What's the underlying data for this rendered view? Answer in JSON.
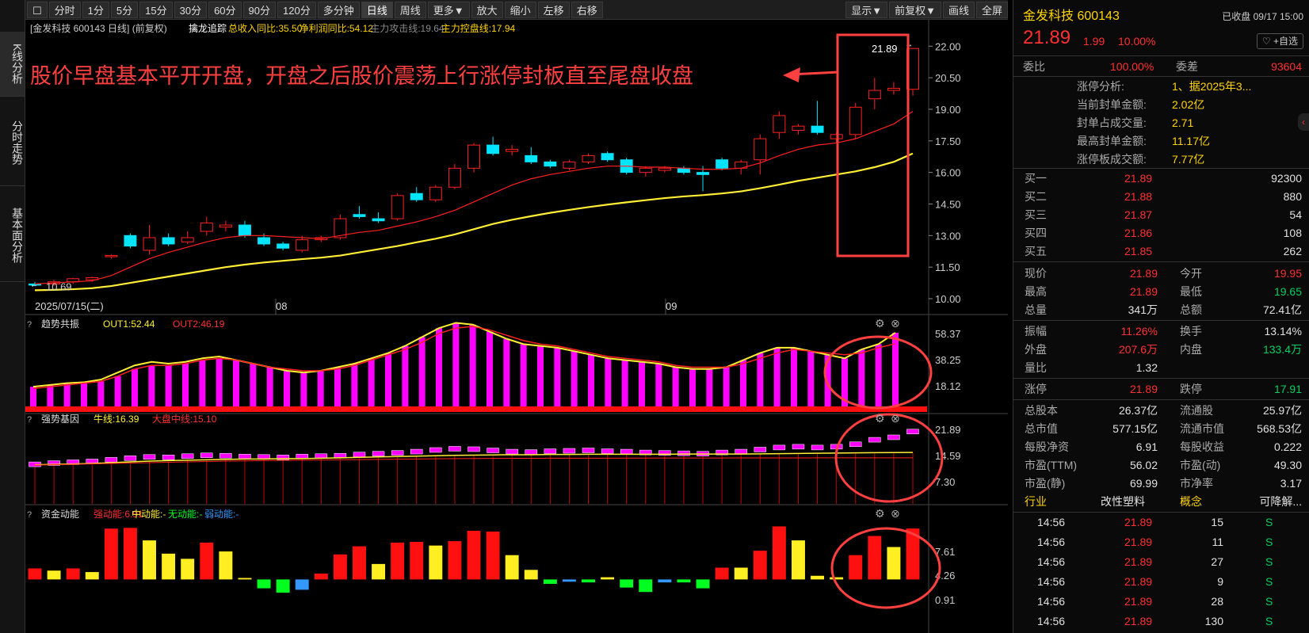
{
  "toolbar": {
    "periods": [
      "分时",
      "1分",
      "5分",
      "15分",
      "30分",
      "60分",
      "90分",
      "120分",
      "多分钟",
      "日线",
      "周线",
      "更多▼",
      "放大",
      "缩小",
      "左移",
      "右移"
    ],
    "active": "日线",
    "right": [
      "显示▼",
      "前复权▼",
      "画线",
      "全屏"
    ]
  },
  "sidetabs": [
    "K线分析",
    "分时走势",
    "基本面分析"
  ],
  "main_header": {
    "title": "[金发科技 600143 日线]",
    "adj": "(前复权)",
    "indicator": "擒龙追踪",
    "items": [
      {
        "text": "总收入同比:35.50",
        "color": "#ffd400"
      },
      {
        "text": "净利润同比:54.12",
        "color": "#ffd400"
      },
      {
        "text": "主力攻击线:19.64",
        "color": "#888888"
      },
      {
        "text": "主力控盘线:17.94",
        "color": "#ffd400"
      }
    ]
  },
  "annotation": "股价早盘基本平开开盘，开盘之后股价震荡上行涨停封板直至尾盘收盘",
  "labels": {
    "last_price": "21.89",
    "low_price": "10.69",
    "start_date": "2025/07/15(二)",
    "month_aug": "08",
    "month_sep": "09"
  },
  "panel1": {
    "name": "趋势共振",
    "out1": "OUT1:52.44",
    "out2": "OUT2:46.19",
    "ticks": [
      "58.37",
      "38.25",
      "18.12"
    ]
  },
  "panel2": {
    "name": "强势基因",
    "l1": "牛线:16.39",
    "l2": "大盘中线:15.10",
    "ticks": [
      "21.89",
      "14.59",
      "7.30"
    ]
  },
  "panel3": {
    "name": "资金动能",
    "l1": "强动能:6.91",
    "l2": "中动能:-",
    "l3": "无动能:-",
    "l4": "弱动能:-",
    "ticks": [
      "7.61",
      "4.26",
      "0.91"
    ]
  },
  "colors": {
    "up": "#ff2020",
    "down": "#00e5ff",
    "ma_short": "#ff2020",
    "ma_long": "#ffee33",
    "magenta": "#ff00ff",
    "annot": "#ff4040"
  },
  "chart_data": {
    "type": "candlestick",
    "title": "金发科技 600143 日线",
    "ylim": [
      10.0,
      22.5
    ],
    "y_ticks": [
      22.0,
      20.5,
      19.0,
      17.5,
      16.0,
      14.5,
      13.0,
      11.5,
      10.0
    ],
    "x_labels": [
      "2025/07/15(二)",
      "08",
      "09"
    ],
    "candles": [
      {
        "o": 10.7,
        "h": 10.8,
        "l": 10.6,
        "c": 10.69
      },
      {
        "o": 10.7,
        "h": 10.9,
        "l": 10.6,
        "c": 10.8
      },
      {
        "o": 10.8,
        "h": 11.0,
        "l": 10.7,
        "c": 10.95
      },
      {
        "o": 10.9,
        "h": 11.05,
        "l": 10.8,
        "c": 11.0
      },
      {
        "o": 12.0,
        "h": 12.1,
        "l": 11.9,
        "c": 12.05
      },
      {
        "o": 13.0,
        "h": 13.1,
        "l": 12.4,
        "c": 12.5
      },
      {
        "o": 12.3,
        "h": 13.5,
        "l": 12.1,
        "c": 12.9
      },
      {
        "o": 12.9,
        "h": 13.1,
        "l": 12.5,
        "c": 12.6
      },
      {
        "o": 12.7,
        "h": 13.2,
        "l": 12.6,
        "c": 12.9
      },
      {
        "o": 13.2,
        "h": 13.9,
        "l": 13.0,
        "c": 13.6
      },
      {
        "o": 13.4,
        "h": 13.7,
        "l": 13.2,
        "c": 13.5
      },
      {
        "o": 13.5,
        "h": 13.7,
        "l": 12.9,
        "c": 13.0
      },
      {
        "o": 12.9,
        "h": 13.1,
        "l": 12.5,
        "c": 12.6
      },
      {
        "o": 12.6,
        "h": 12.7,
        "l": 12.3,
        "c": 12.4
      },
      {
        "o": 12.3,
        "h": 13.0,
        "l": 12.2,
        "c": 12.8
      },
      {
        "o": 12.8,
        "h": 13.0,
        "l": 12.7,
        "c": 12.9
      },
      {
        "o": 12.9,
        "h": 14.0,
        "l": 12.8,
        "c": 13.8
      },
      {
        "o": 14.0,
        "h": 14.4,
        "l": 13.8,
        "c": 13.9
      },
      {
        "o": 13.8,
        "h": 14.1,
        "l": 13.6,
        "c": 13.7
      },
      {
        "o": 13.8,
        "h": 15.0,
        "l": 13.7,
        "c": 14.9
      },
      {
        "o": 15.0,
        "h": 15.3,
        "l": 14.6,
        "c": 14.7
      },
      {
        "o": 14.7,
        "h": 15.4,
        "l": 14.6,
        "c": 15.3
      },
      {
        "o": 15.3,
        "h": 16.4,
        "l": 15.2,
        "c": 16.2
      },
      {
        "o": 16.2,
        "h": 17.4,
        "l": 16.0,
        "c": 17.3
      },
      {
        "o": 17.3,
        "h": 17.7,
        "l": 16.8,
        "c": 16.9
      },
      {
        "o": 17.0,
        "h": 17.3,
        "l": 16.8,
        "c": 17.1
      },
      {
        "o": 16.8,
        "h": 17.2,
        "l": 16.4,
        "c": 16.5
      },
      {
        "o": 16.5,
        "h": 16.6,
        "l": 16.2,
        "c": 16.3
      },
      {
        "o": 16.2,
        "h": 16.6,
        "l": 16.1,
        "c": 16.5
      },
      {
        "o": 16.5,
        "h": 16.9,
        "l": 16.4,
        "c": 16.8
      },
      {
        "o": 16.9,
        "h": 17.0,
        "l": 16.5,
        "c": 16.6
      },
      {
        "o": 16.6,
        "h": 16.7,
        "l": 15.9,
        "c": 16.0
      },
      {
        "o": 16.0,
        "h": 16.3,
        "l": 15.8,
        "c": 16.2
      },
      {
        "o": 16.1,
        "h": 16.3,
        "l": 16.0,
        "c": 16.2
      },
      {
        "o": 16.2,
        "h": 16.3,
        "l": 15.9,
        "c": 16.0
      },
      {
        "o": 16.0,
        "h": 16.3,
        "l": 15.1,
        "c": 15.9
      },
      {
        "o": 16.6,
        "h": 16.7,
        "l": 16.1,
        "c": 16.2
      },
      {
        "o": 16.2,
        "h": 16.6,
        "l": 15.9,
        "c": 16.5
      },
      {
        "o": 16.6,
        "h": 17.8,
        "l": 15.9,
        "c": 17.6
      },
      {
        "o": 17.9,
        "h": 18.9,
        "l": 17.6,
        "c": 18.7
      },
      {
        "o": 18.0,
        "h": 18.3,
        "l": 17.8,
        "c": 18.2
      },
      {
        "o": 18.2,
        "h": 19.4,
        "l": 17.8,
        "c": 17.9
      },
      {
        "o": 17.6,
        "h": 17.9,
        "l": 17.4,
        "c": 17.8
      },
      {
        "o": 17.8,
        "h": 19.3,
        "l": 17.6,
        "c": 19.1
      },
      {
        "o": 19.5,
        "h": 20.5,
        "l": 19.0,
        "c": 19.9
      },
      {
        "o": 19.9,
        "h": 20.3,
        "l": 19.7,
        "c": 20.0
      },
      {
        "o": 19.95,
        "h": 21.89,
        "l": 19.65,
        "c": 21.89
      }
    ],
    "ma_short": [
      10.7,
      10.75,
      10.8,
      10.85,
      11.1,
      11.5,
      11.9,
      12.2,
      12.45,
      12.7,
      12.9,
      13.0,
      13.0,
      12.95,
      12.9,
      12.85,
      13.0,
      13.15,
      13.25,
      13.45,
      13.65,
      13.9,
      14.2,
      14.6,
      15.0,
      15.4,
      15.7,
      15.9,
      16.05,
      16.2,
      16.3,
      16.3,
      16.25,
      16.25,
      16.2,
      16.15,
      16.15,
      16.2,
      16.45,
      16.8,
      17.1,
      17.3,
      17.4,
      17.6,
      17.95,
      18.3,
      18.9
    ],
    "ma_long": [
      10.4,
      10.42,
      10.45,
      10.5,
      10.6,
      10.75,
      10.9,
      11.05,
      11.2,
      11.35,
      11.5,
      11.62,
      11.72,
      11.8,
      11.88,
      11.95,
      12.05,
      12.2,
      12.35,
      12.5,
      12.68,
      12.85,
      13.05,
      13.3,
      13.55,
      13.75,
      13.92,
      14.08,
      14.22,
      14.35,
      14.47,
      14.58,
      14.68,
      14.78,
      14.86,
      14.92,
      15.0,
      15.1,
      15.25,
      15.42,
      15.6,
      15.75,
      15.9,
      16.05,
      16.25,
      16.5,
      16.9
    ],
    "indicator1": {
      "ylim": [
        10,
        60
      ],
      "bars": [
        22,
        23,
        24,
        24,
        25,
        28,
        32,
        34,
        34,
        35,
        37,
        38,
        37,
        35,
        33,
        31,
        30,
        31,
        33,
        35,
        38,
        41,
        45,
        50,
        55,
        58,
        57,
        53,
        49,
        46,
        45,
        44,
        42,
        40,
        38,
        37,
        36,
        35,
        33,
        32,
        32,
        33,
        37,
        41,
        44,
        44,
        42,
        40,
        38,
        43,
        46,
        52.44
      ],
      "out1": [
        22,
        23,
        24,
        24.5,
        26,
        30,
        34,
        36,
        35,
        36,
        38,
        39,
        37,
        35,
        33,
        31,
        30,
        31,
        33,
        35,
        38,
        41,
        45,
        50,
        55,
        58,
        57,
        53,
        49,
        46,
        45,
        44,
        42,
        40,
        38,
        37,
        36,
        35,
        33,
        32,
        32,
        33,
        37,
        41,
        44,
        44,
        42,
        40,
        38,
        43,
        46,
        52.44
      ],
      "out2": [
        21,
        22,
        23,
        24,
        25,
        28,
        32,
        34,
        34,
        35,
        37,
        38,
        37,
        35,
        33,
        32,
        31,
        31,
        32,
        34,
        37,
        40,
        43,
        47,
        52,
        55,
        56,
        54,
        51,
        48,
        46,
        45,
        43,
        41,
        39,
        38,
        37,
        36,
        34,
        33,
        33,
        33,
        35,
        38,
        41,
        43,
        42,
        41,
        40,
        41,
        44,
        46.19
      ]
    },
    "indicator2": {
      "ylim": [
        5,
        23
      ],
      "boxes": [
        13.5,
        13.8,
        14.0,
        14.2,
        14.6,
        15.0,
        15.3,
        15.2,
        15.5,
        15.7,
        15.6,
        15.4,
        15.3,
        15.2,
        15.4,
        15.5,
        15.6,
        15.9,
        16.1,
        16.3,
        16.6,
        17.0,
        17.3,
        17.2,
        16.9,
        16.6,
        16.5,
        16.7,
        16.8,
        16.9,
        16.7,
        16.6,
        16.4,
        16.3,
        16.2,
        16.1,
        16.4,
        16.6,
        17.1,
        17.6,
        17.8,
        17.6,
        17.8,
        18.4,
        19.5,
        20.1,
        21.5
      ],
      "bull": [
        13.4,
        13.5,
        13.6,
        13.7,
        13.9,
        14.1,
        14.3,
        14.4,
        14.5,
        14.6,
        14.7,
        14.8,
        14.8,
        14.9,
        14.9,
        15.0,
        15.1,
        15.2,
        15.3,
        15.4,
        15.5,
        15.6,
        15.7,
        15.75,
        15.8,
        15.85,
        15.85,
        15.9,
        15.9,
        15.95,
        15.95,
        15.95,
        15.95,
        15.95,
        16.0,
        16.0,
        16.0,
        16.0,
        16.05,
        16.1,
        16.15,
        16.2,
        16.25,
        16.3,
        16.35,
        16.38,
        16.39
      ],
      "mid": [
        13.3,
        13.4,
        13.5,
        13.6,
        13.7,
        13.8,
        13.9,
        14.0,
        14.1,
        14.2,
        14.3,
        14.35,
        14.4,
        14.45,
        14.5,
        14.55,
        14.6,
        14.65,
        14.7,
        14.75,
        14.8,
        14.85,
        14.9,
        14.92,
        14.94,
        14.96,
        14.97,
        14.98,
        14.99,
        15.0,
        15.0,
        15.01,
        15.02,
        15.03,
        15.04,
        15.05,
        15.05,
        15.06,
        15.06,
        15.07,
        15.07,
        15.08,
        15.08,
        15.09,
        15.09,
        15.1,
        15.1
      ]
    },
    "indicator3": {
      "ylim": [
        -2,
        8
      ],
      "bars": [
        {
          "v": 1.5,
          "c": "r"
        },
        {
          "v": 1.2,
          "c": "y"
        },
        {
          "v": 1.5,
          "c": "r"
        },
        {
          "v": 1.0,
          "c": "y"
        },
        {
          "v": 6.9,
          "c": "r"
        },
        {
          "v": 7.0,
          "c": "r"
        },
        {
          "v": 5.3,
          "c": "y"
        },
        {
          "v": 3.5,
          "c": "y"
        },
        {
          "v": 2.8,
          "c": "y"
        },
        {
          "v": 5.0,
          "c": "r"
        },
        {
          "v": 3.8,
          "c": "y"
        },
        {
          "v": 0.2,
          "c": "y"
        },
        {
          "v": -1.2,
          "c": "g"
        },
        {
          "v": -1.8,
          "c": "g"
        },
        {
          "v": -1.4,
          "c": "b"
        },
        {
          "v": 0.8,
          "c": "r"
        },
        {
          "v": 3.4,
          "c": "r"
        },
        {
          "v": 4.5,
          "c": "r"
        },
        {
          "v": 2.1,
          "c": "y"
        },
        {
          "v": 5.0,
          "c": "r"
        },
        {
          "v": 5.1,
          "c": "r"
        },
        {
          "v": 4.6,
          "c": "y"
        },
        {
          "v": 5.2,
          "c": "r"
        },
        {
          "v": 6.6,
          "c": "r"
        },
        {
          "v": 6.5,
          "c": "r"
        },
        {
          "v": 3.3,
          "c": "y"
        },
        {
          "v": 1.3,
          "c": "y"
        },
        {
          "v": -0.6,
          "c": "g"
        },
        {
          "v": -0.3,
          "c": "b"
        },
        {
          "v": -0.4,
          "c": "g"
        },
        {
          "v": 0.3,
          "c": "y"
        },
        {
          "v": -1.1,
          "c": "g"
        },
        {
          "v": -1.7,
          "c": "g"
        },
        {
          "v": -0.4,
          "c": "b"
        },
        {
          "v": -0.4,
          "c": "g"
        },
        {
          "v": -1.2,
          "c": "g"
        },
        {
          "v": 1.6,
          "c": "r"
        },
        {
          "v": 1.6,
          "c": "y"
        },
        {
          "v": 3.9,
          "c": "r"
        },
        {
          "v": 7.2,
          "c": "r"
        },
        {
          "v": 5.3,
          "c": "y"
        },
        {
          "v": 0.5,
          "c": "y"
        },
        {
          "v": 0.3,
          "c": "y"
        },
        {
          "v": 3.3,
          "c": "r"
        },
        {
          "v": 5.9,
          "c": "r"
        },
        {
          "v": 4.4,
          "c": "y"
        },
        {
          "v": 6.91,
          "c": "r"
        }
      ]
    }
  },
  "right": {
    "name": "金发科技 600143",
    "status": "已收盘 09/17 15:00",
    "price": "21.89",
    "change": "1.99",
    "pct": "10.00%",
    "watch": "+自选",
    "weibi_label": "委比",
    "weibi": "100.00%",
    "weicha_label": "委差",
    "weicha": "93604",
    "limit_info": [
      {
        "k": "涨停分析:",
        "v": "1、据2025年3..."
      },
      {
        "k": "当前封单金额:",
        "v": "2.02亿"
      },
      {
        "k": "封单占成交量:",
        "v": "2.71"
      },
      {
        "k": "最高封单金额:",
        "v": "11.17亿"
      },
      {
        "k": "涨停板成交额:",
        "v": "7.77亿"
      }
    ],
    "bids": [
      {
        "k": "买一",
        "p": "21.89",
        "v": "92300"
      },
      {
        "k": "买二",
        "p": "21.88",
        "v": "880"
      },
      {
        "k": "买三",
        "p": "21.87",
        "v": "54"
      },
      {
        "k": "买四",
        "p": "21.86",
        "v": "108"
      },
      {
        "k": "买五",
        "p": "21.85",
        "v": "262"
      }
    ],
    "stats1": [
      {
        "k1": "现价",
        "v1": "21.89",
        "c1": "red",
        "k2": "今开",
        "v2": "19.95",
        "c2": "red"
      },
      {
        "k1": "最高",
        "v1": "21.89",
        "c1": "red",
        "k2": "最低",
        "v2": "19.65",
        "c2": "green"
      },
      {
        "k1": "总量",
        "v1": "341万",
        "c1": "white",
        "k2": "总额",
        "v2": "72.41亿",
        "c2": "white"
      }
    ],
    "stats2": [
      {
        "k1": "振幅",
        "v1": "11.26%",
        "c1": "red",
        "k2": "换手",
        "v2": "13.14%",
        "c2": "white"
      },
      {
        "k1": "外盘",
        "v1": "207.6万",
        "c1": "red",
        "k2": "内盘",
        "v2": "133.4万",
        "c2": "green"
      },
      {
        "k1": "量比",
        "v1": "1.32",
        "c1": "white",
        "k2": "",
        "v2": "",
        "c2": "white"
      }
    ],
    "stats3": [
      {
        "k1": "涨停",
        "v1": "21.89",
        "c1": "red",
        "k2": "跌停",
        "v2": "17.91",
        "c2": "green"
      }
    ],
    "stats4": [
      {
        "k1": "总股本",
        "v1": "26.37亿",
        "c1": "white",
        "k2": "流通股",
        "v2": "25.97亿",
        "c2": "white"
      },
      {
        "k1": "总市值",
        "v1": "577.15亿",
        "c1": "white",
        "k2": "流通市值",
        "v2": "568.53亿",
        "c2": "white"
      },
      {
        "k1": "每股净资",
        "v1": "6.91",
        "c1": "white",
        "k2": "每股收益",
        "v2": "0.222",
        "c2": "white"
      },
      {
        "k1": "市盈(TTM)",
        "v1": "56.02",
        "c1": "white",
        "k2": "市盈(动)",
        "v2": "49.30",
        "c2": "white"
      },
      {
        "k1": "市盈(静)",
        "v1": "69.99",
        "c1": "white",
        "k2": "市净率",
        "v2": "3.17",
        "c2": "white"
      }
    ],
    "industry": {
      "k1": "行业",
      "v1": "改性塑料",
      "k2": "概念",
      "v2": "可降解..."
    },
    "trades": [
      {
        "t": "14:56",
        "p": "21.89",
        "v": "15",
        "s": "S"
      },
      {
        "t": "14:56",
        "p": "21.89",
        "v": "11",
        "s": "S"
      },
      {
        "t": "14:56",
        "p": "21.89",
        "v": "27",
        "s": "S"
      },
      {
        "t": "14:56",
        "p": "21.89",
        "v": "9",
        "s": "S"
      },
      {
        "t": "14:56",
        "p": "21.89",
        "v": "28",
        "s": "S"
      },
      {
        "t": "14:56",
        "p": "21.89",
        "v": "130",
        "s": "S"
      }
    ]
  }
}
